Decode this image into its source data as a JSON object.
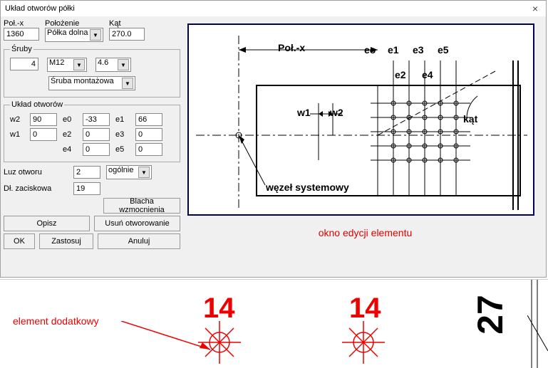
{
  "window": {
    "title": "Układ otworów półki"
  },
  "top_fields": {
    "pol_x_label": "Poł.-x",
    "pol_x_value": "1360",
    "polozenie_label": "Położenie",
    "polozenie_value": "Półka dolna",
    "kat_label": "Kąt",
    "kat_value": "270.0"
  },
  "sruby": {
    "legend": "Śruby",
    "count": "4",
    "size": "M12",
    "grade": "4.6",
    "type": "Śruba montażowa"
  },
  "uklad": {
    "legend": "Układ otworów",
    "w2": "90",
    "e0": "-33",
    "e1": "66",
    "w1": "0",
    "e2": "0",
    "e3": "0",
    "e4": "0",
    "e5": "0"
  },
  "misc": {
    "luz_label": "Luz otworu",
    "luz_value": "2",
    "luz_mode": "ogólnie",
    "dl_label": "Dł. zaciskowa",
    "dl_value": "19"
  },
  "buttons": {
    "blacha": "Blacha wzmocnienia",
    "opisz": "Opisz",
    "usun": "Usuń otworowanie",
    "ok": "OK",
    "zastosuj": "Zastosuj",
    "anuluj": "Anuluj"
  },
  "diagram_labels": {
    "polx": "Poł.-x",
    "eo": "eo",
    "e1": "e1",
    "e3": "e3",
    "e5": "e5",
    "e2": "e2",
    "e4": "e4",
    "w1": "w1",
    "w2": "w2",
    "kat": "kąt",
    "wezel": "węzeł systemowy",
    "okno": "okno edycji elementu"
  },
  "bottom": {
    "element": "element dodatkowy",
    "n14a": "14",
    "n14b": "14",
    "n27": "27"
  }
}
